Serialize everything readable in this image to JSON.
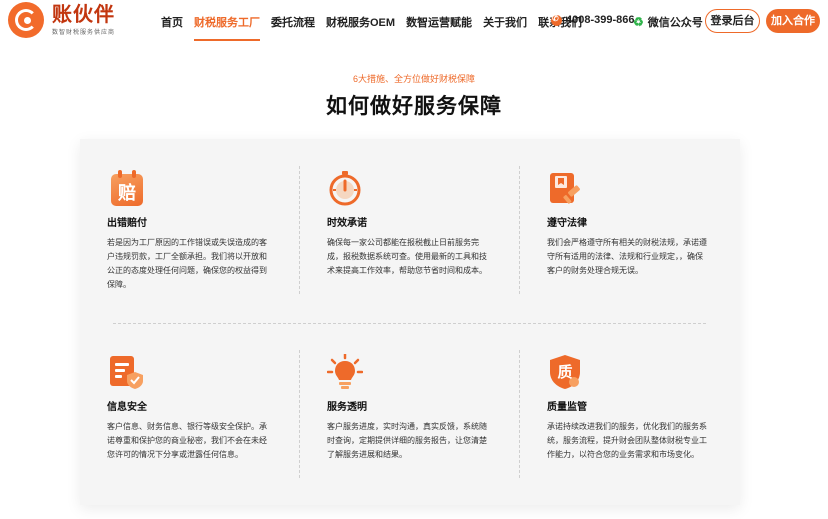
{
  "header": {
    "brand_name": "账伙伴",
    "brand_sub": "数智财税服务供应商",
    "nav": [
      {
        "label": "首页",
        "active": false
      },
      {
        "label": "财税服务工厂",
        "active": true
      },
      {
        "label": "委托流程",
        "active": false
      },
      {
        "label": "财税服务OEM",
        "active": false
      },
      {
        "label": "数智运营赋能",
        "active": false
      },
      {
        "label": "关于我们",
        "active": false
      },
      {
        "label": "联系我们",
        "active": false
      }
    ],
    "phone": "4008-399-866",
    "wechat": "微信公众号",
    "login_label": "登录后台",
    "join_label": "加入合作"
  },
  "section": {
    "subtitle": "6大措施、全方位做好财税保障",
    "title": "如何做好服务保障"
  },
  "items": [
    {
      "icon": "compensation-icon",
      "icon_text": "赔",
      "title": "出错赔付",
      "desc": "若是因为工厂原因的工作错误或失误造成的客户违规罚款，工厂全额承担。我们将以开放和公正的态度处理任何问题，确保您的权益得到保障。"
    },
    {
      "icon": "stopwatch-icon",
      "icon_text": "",
      "title": "时效承诺",
      "desc": "确保每一家公司都能在报税截止日前服务完成，报税数据系统可查。使用最新的工具和技术来提高工作效率，帮助您节省时间和成本。"
    },
    {
      "icon": "law-hammer-icon",
      "icon_text": "",
      "title": "遵守法律",
      "desc": "我们会严格遵守所有相关的财税法规，承诺遵守所有适用的法律、法规和行业规定，，确保客户的财务处理合规无误。"
    },
    {
      "icon": "info-shield-icon",
      "icon_text": "",
      "title": "信息安全",
      "desc": "客户信息、财务信息、银行等级安全保护。承诺尊重和保护您的商业秘密，我们不会在未经您许可的情况下分享或泄露任何信息。"
    },
    {
      "icon": "lightbulb-icon",
      "icon_text": "",
      "title": "服务透明",
      "desc": "客户服务进度，实时沟通，真实反馈，系统随时查询，定期提供详细的服务报告，让您清楚了解服务进展和结果。"
    },
    {
      "icon": "quality-badge-icon",
      "icon_text": "质",
      "title": "质量监管",
      "desc": "承诺持续改进我们的服务，优化我们的服务系统，服务流程，提升财会团队整体财税专业工作能力，以符合您的业务需求和市场变化。"
    }
  ],
  "colors": {
    "accent": "#ee6a2a",
    "brand": "#c2360f"
  }
}
